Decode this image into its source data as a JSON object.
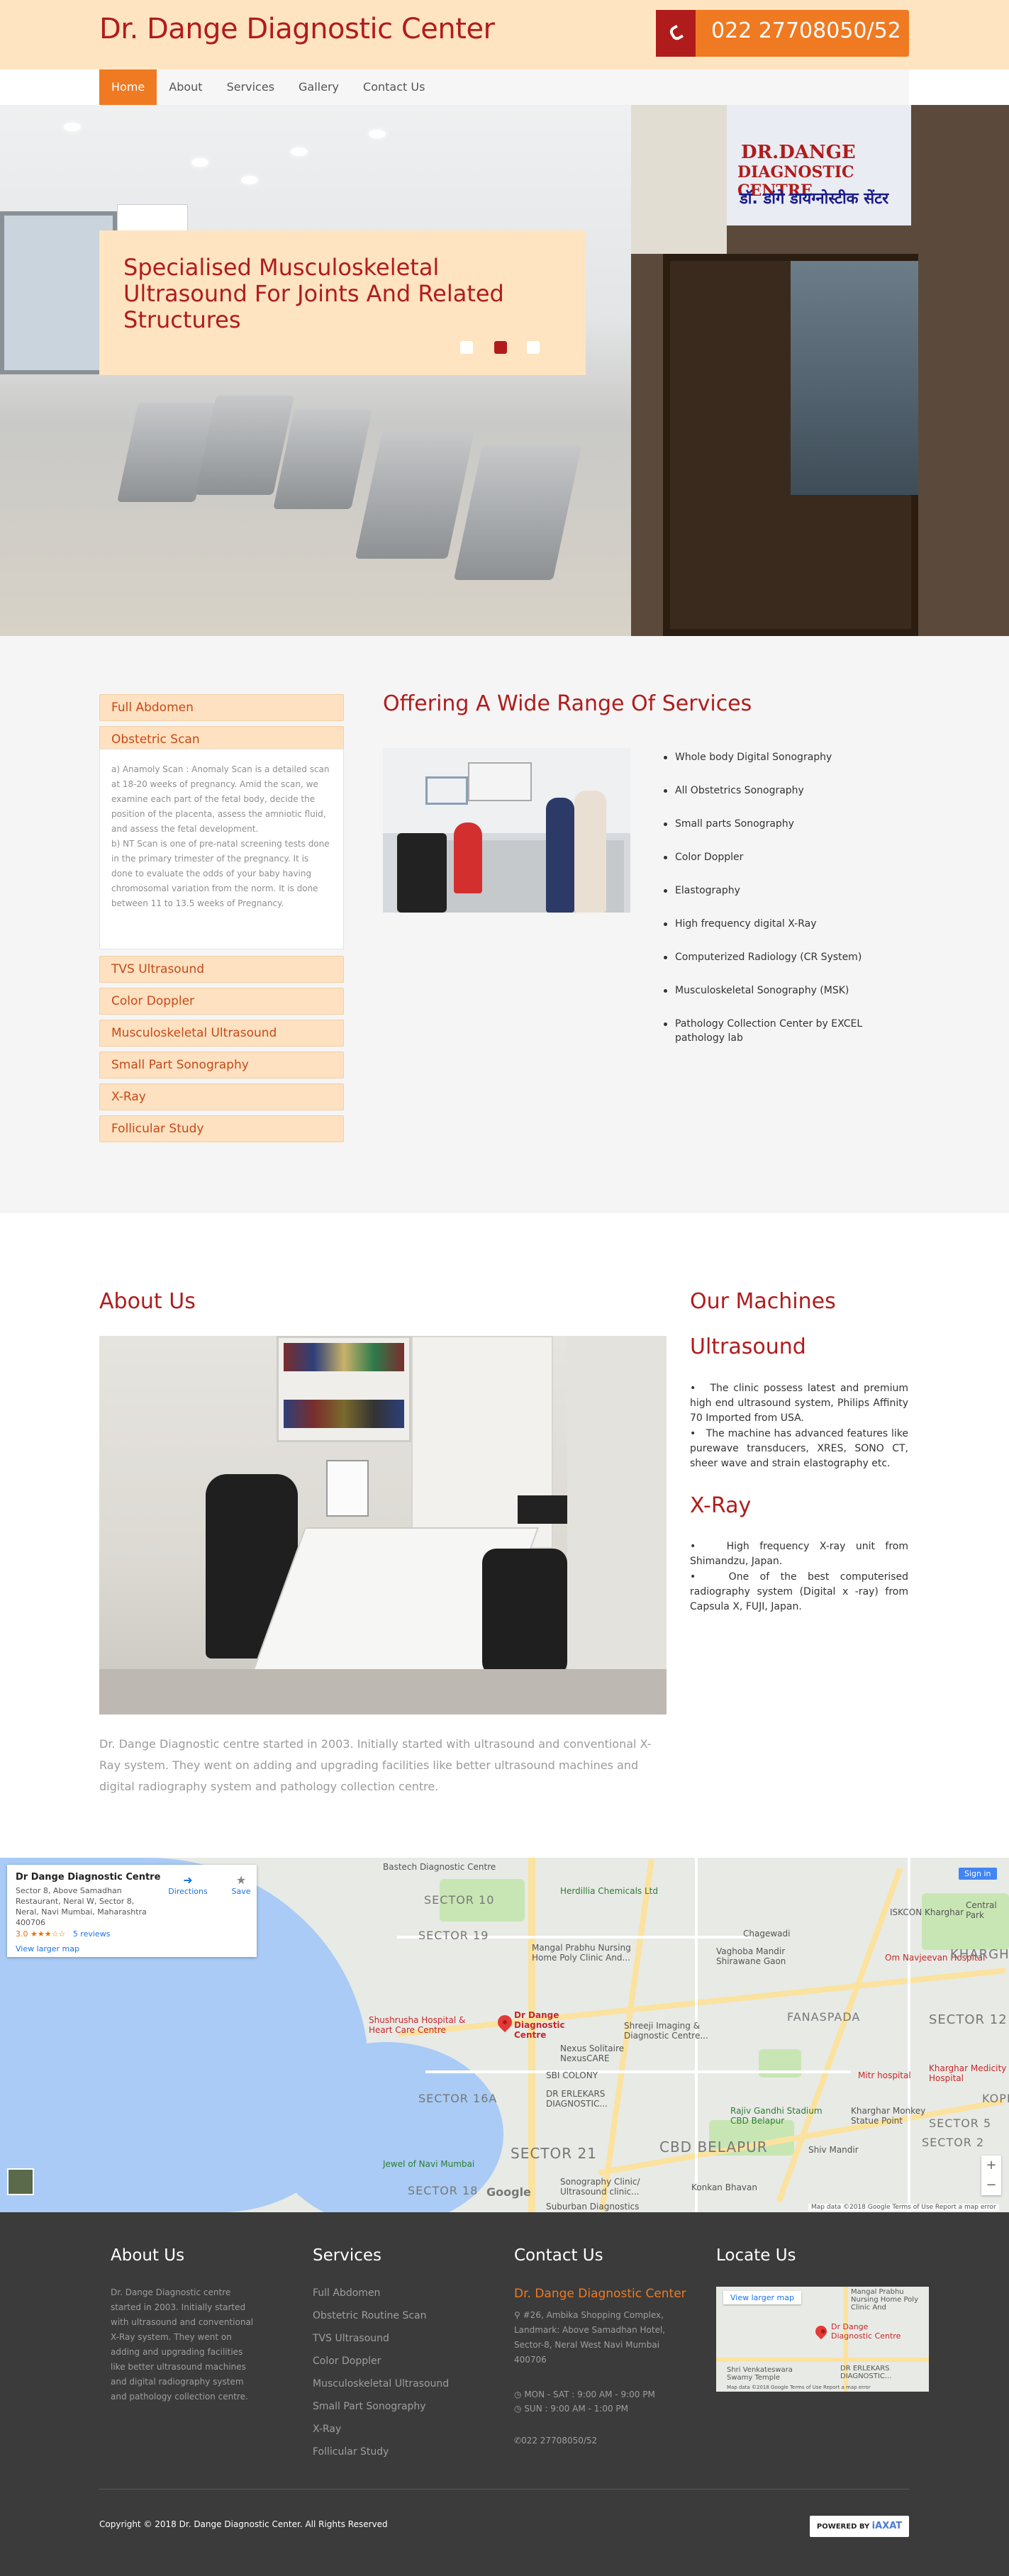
{
  "header": {
    "brand": "Dr. Dange Diagnostic Center",
    "phone": "022 27708050/52",
    "phone_icon": "phone-icon"
  },
  "nav": {
    "items": [
      {
        "label": "Home",
        "active": true
      },
      {
        "label": "About",
        "active": false
      },
      {
        "label": "Services",
        "active": false
      },
      {
        "label": "Gallery",
        "active": false
      },
      {
        "label": "Contact Us",
        "active": false
      }
    ]
  },
  "hero": {
    "caption": "Specialised Musculoskeletal Ultrasound For Joints And Related Structures",
    "active_slide": 2,
    "slide_count": 3,
    "sign": {
      "line1": "DR.DANGE",
      "line2": "DIAGNOSTIC CENTRE",
      "line3": "डॉ. डांगे डायग्नोस्टीक सेंटर"
    }
  },
  "services_accordion": {
    "items": [
      "Full Abdomen",
      "Obstetric Scan",
      "TVS Ultrasound",
      "Color Doppler",
      "Musculoskeletal Ultrasound",
      "Small Part Sonography",
      "X-Ray",
      "Follicular Study"
    ],
    "open_index": 1,
    "open_text": "a) Anamoly Scan : Anomaly Scan is a detailed scan at 18-20 weeks of pregnancy. Amid the scan, we examine each part of the fetal body, decide the position of the placenta, assess the amniotic fluid, and assess the fetal development.\nb) NT Scan is one of pre-natal screening tests done in the primary trimester of the pregnancy. It is done to evaluate the odds of your baby having chromosomal variation from the norm. It is done between 11 to 13.5 weeks of Pregnancy."
  },
  "services": {
    "title": "Offering A Wide Range Of Services",
    "list": [
      "Whole body Digital Sonography",
      "All Obstetrics Sonography",
      "Small parts Sonography",
      "Color Doppler",
      "Elastography",
      "High frequency digital X-Ray",
      "Computerized Radiology (CR System)",
      "Musculoskeletal Sonography (MSK)",
      "Pathology Collection Center by EXCEL pathology lab"
    ]
  },
  "about": {
    "title": "About Us",
    "text": "Dr. Dange Diagnostic centre started in 2003. Initially started with ultrasound and conventional X-Ray system. They went on adding and upgrading facilities like better ultrasound machines and digital radiography system and pathology collection centre."
  },
  "machines": {
    "title": "Our Machines",
    "ultrasound_title": "Ultrasound",
    "ultrasound_points": [
      "The clinic possess latest and premium high end ultrasound system, Philips Affinity 70 Imported from USA.",
      "The machine has advanced features like purewave transducers, XRES, SONO CT, sheer wave and strain elastography etc."
    ],
    "xray_title": "X-Ray",
    "xray_points": [
      "High frequency X-ray unit from Shimandzu, Japan.",
      "One of the best computerised radiography system (Digital x -ray) from Capsula X, FUJI, Japan."
    ]
  },
  "map": {
    "place_name": "Dr Dange Diagnostic Centre",
    "address": "Sector 8, Above Samadhan Restaurant, Neral W, Sector 8, Neral, Navi Mumbai, Maharashtra 400706",
    "rating": "3.0",
    "stars": "★★★☆☆",
    "reviews": "5 reviews",
    "view_larger": "View larger map",
    "directions": "Directions",
    "save": "Save",
    "sign_in": "Sign in",
    "pin_label": "Dr Dange Diagnostic Centre",
    "attribution": "Map data ©2018 Google   Terms of Use   Report a map error",
    "google": "Google",
    "labels": [
      "Bastech Diagnostic Centre",
      "SECTOR 10",
      "SECTOR 19",
      "Herdillia Chemicals Ltd",
      "Mangal Prabhu Nursing Home Poly Clinic And...",
      "Chagewadi",
      "ISKCON Kharghar",
      "Central Park",
      "Om Navjeevan Hospital",
      "Shushrusha Hospital & Heart Care Centre",
      "Shreeji Imaging & Diagnostic Centre...",
      "FANASPADA",
      "KHARGHAR",
      "SECTOR 12",
      "Nexus Solitaire NexusCARE",
      "SBI COLONY",
      "SECTOR 16A",
      "DR ERLEKARS DIAGNOSTIC...",
      "Rajiv Gandhi Stadium CBD Belapur",
      "Mitr hospital",
      "Kharghar Monkey Statue Point",
      "Kharghar Medicity Hospital",
      "CBD BELAPUR",
      "SECTOR 21",
      "SECTOR 2",
      "Jewel of Navi Mumbai",
      "Sonography Clinic/ Ultrasound clinic...",
      "Konkan Bhavan",
      "SECTOR 18",
      "Suburban Diagnostics",
      "Shiv Mandir",
      "Vaghoba Mandir Shirawane Gaon",
      "SECTOR 5",
      "KOPRA"
    ]
  },
  "footer": {
    "about_title": "About Us",
    "about_text": "Dr. Dange Diagnostic centre started in 2003. Initially started with ultrasound and conventional X-Ray system. They went on adding and upgrading facilities like better ultrasound machines and digital radiography system and pathology collection centre.",
    "services_title": "Services",
    "services_links": [
      "Full Abdomen",
      "Obstetric Routine Scan",
      "TVS Ultrasound",
      "Color Doppler",
      "Musculoskeletal Ultrasound",
      "Small Part Sonography",
      "X-Ray",
      "Follicular Study"
    ],
    "contact_title": "Contact Us",
    "contact_brand": "Dr. Dange Diagnostic Center",
    "contact_address": "#26, Ambika Shopping Complex, Landmark: Above Samadhan Hotel, Sector-8, Neral West Navi Mumbai 400706",
    "hours_weekday": "MON - SAT : 9:00 AM - 9:00 PM",
    "hours_sunday": "SUN : 9:00 AM - 1:00 PM",
    "contact_phone": "022 27708050/52",
    "locate_title": "Locate Us",
    "locate_view_larger": "View larger map",
    "locate_labels": [
      "Mangal Prabhu Nursing Home Poly Clinic And",
      "Dr Dange Diagnostic Centre",
      "Shri Venkateswara Swamy Temple",
      "DR ERLEKARS DIAGNOSTIC..."
    ],
    "locate_attr": "Map data ©2018 Google   Terms of Use   Report a map error",
    "copyright": "Copyright © 2018 Dr. Dange Diagnostic Center. All Rights Reserved",
    "powered_by": "POWERED BY",
    "powered_brand": "iAXAT"
  },
  "colors": {
    "brand_red": "#b01c1c",
    "accent_orange": "#ef7a22",
    "peach": "#ffe4c1",
    "footer_bg": "#3b3b3b"
  }
}
